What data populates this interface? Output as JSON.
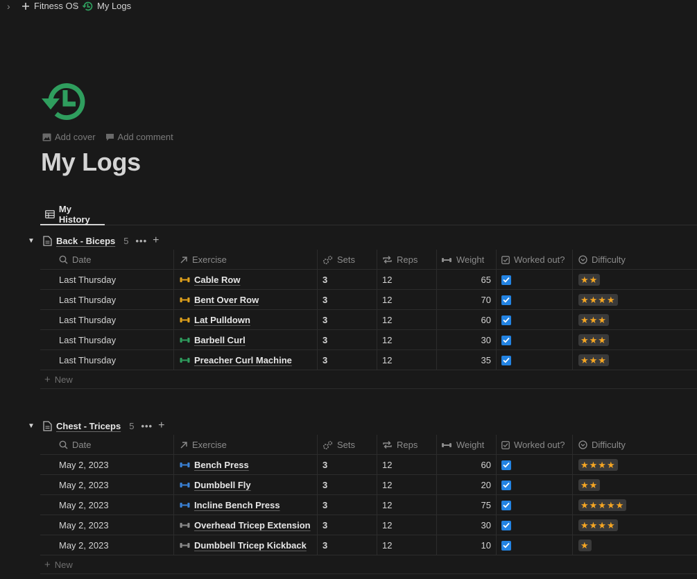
{
  "breadcrumb": {
    "workspace": "Fitness OS",
    "separator": "/",
    "page": "My Logs"
  },
  "page": {
    "title": "My Logs",
    "icon": "history-clock-icon",
    "icon_color": "#2f9e5e",
    "add_cover": "Add cover",
    "add_comment": "Add comment"
  },
  "view_tab": {
    "label": "My History"
  },
  "columns": {
    "date": "Date",
    "exercise": "Exercise",
    "sets": "Sets",
    "reps": "Reps",
    "weight": "Weight",
    "worked_out": "Worked out?",
    "difficulty": "Difficulty"
  },
  "new_label": "New",
  "groups": [
    {
      "name": "Back - Biceps",
      "count": "5",
      "more": "•••",
      "rows": [
        {
          "date": "Last Thursday",
          "exercise": "Cable Row",
          "icon_color": "#e0a11b",
          "sets": "3",
          "reps": "12",
          "weight": "65",
          "worked_out": true,
          "difficulty": 2
        },
        {
          "date": "Last Thursday",
          "exercise": "Bent Over Row",
          "icon_color": "#e0a11b",
          "sets": "3",
          "reps": "12",
          "weight": "70",
          "worked_out": true,
          "difficulty": 4
        },
        {
          "date": "Last Thursday",
          "exercise": "Lat Pulldown",
          "icon_color": "#e0a11b",
          "sets": "3",
          "reps": "12",
          "weight": "60",
          "worked_out": true,
          "difficulty": 3
        },
        {
          "date": "Last Thursday",
          "exercise": "Barbell Curl",
          "icon_color": "#2f9e5e",
          "sets": "3",
          "reps": "12",
          "weight": "30",
          "worked_out": true,
          "difficulty": 3
        },
        {
          "date": "Last Thursday",
          "exercise": "Preacher Curl Machine",
          "icon_color": "#2f9e5e",
          "sets": "3",
          "reps": "12",
          "weight": "35",
          "worked_out": true,
          "difficulty": 3
        }
      ]
    },
    {
      "name": "Chest - Triceps",
      "count": "5",
      "more": "•••",
      "rows": [
        {
          "date": "May 2, 2023",
          "exercise": "Bench Press",
          "icon_color": "#3b82d6",
          "sets": "3",
          "reps": "12",
          "weight": "60",
          "worked_out": true,
          "difficulty": 4
        },
        {
          "date": "May 2, 2023",
          "exercise": "Dumbbell Fly",
          "icon_color": "#3b82d6",
          "sets": "3",
          "reps": "12",
          "weight": "20",
          "worked_out": true,
          "difficulty": 2
        },
        {
          "date": "May 2, 2023",
          "exercise": "Incline Bench Press",
          "icon_color": "#3b82d6",
          "sets": "3",
          "reps": "12",
          "weight": "75",
          "worked_out": true,
          "difficulty": 5
        },
        {
          "date": "May 2, 2023",
          "exercise": "Overhead Tricep Extension",
          "icon_color": "#8a8a8a",
          "sets": "3",
          "reps": "12",
          "weight": "30",
          "worked_out": true,
          "difficulty": 4
        },
        {
          "date": "May 2, 2023",
          "exercise": "Dumbbell Tricep Kickback",
          "icon_color": "#8a8a8a",
          "sets": "3",
          "reps": "12",
          "weight": "10",
          "worked_out": true,
          "difficulty": 1
        }
      ]
    }
  ]
}
